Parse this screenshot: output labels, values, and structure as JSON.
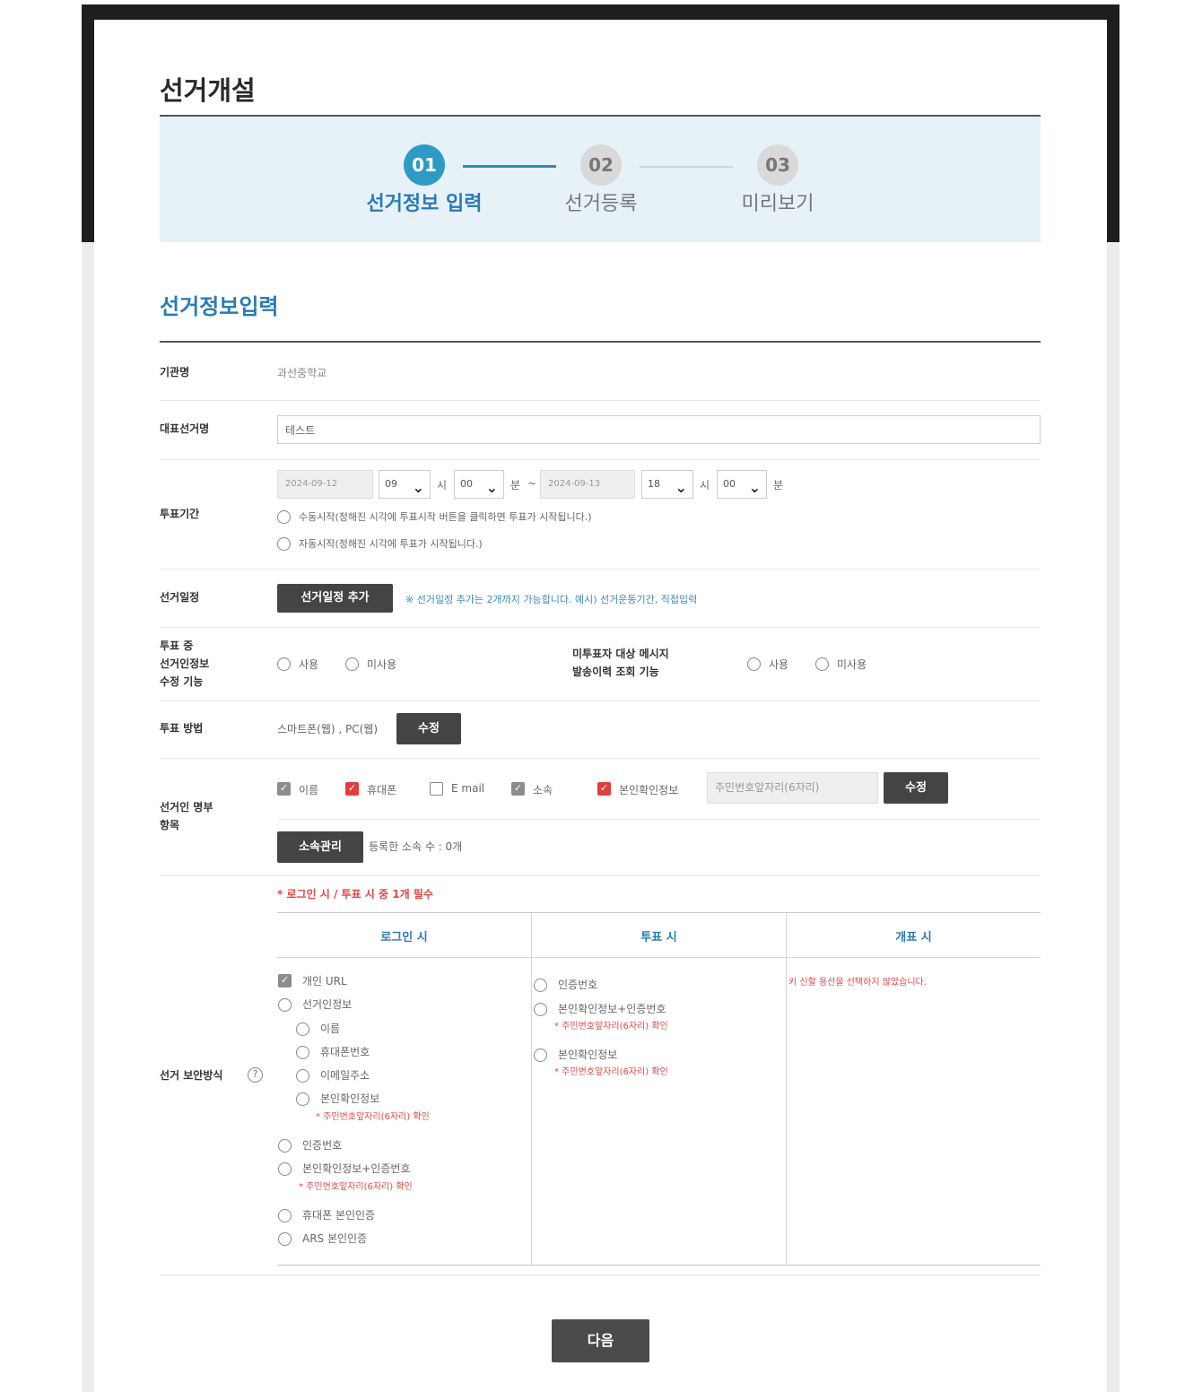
{
  "page_title": "선거개설",
  "steps": [
    {
      "num": "01",
      "label": "선거정보 입력",
      "active": true
    },
    {
      "num": "02",
      "label": "선거등록",
      "active": false
    },
    {
      "num": "03",
      "label": "미리보기",
      "active": false
    }
  ],
  "section_title": "선거정보입력",
  "org": {
    "label": "기관명",
    "value": "과선중학교"
  },
  "election_name": {
    "label": "대표선거명",
    "value": "테스트"
  },
  "vote_period": {
    "label": "투표기간",
    "start_date": "2024-09-12",
    "start_hour": "09",
    "start_min": "00",
    "end_date": "2024-09-13",
    "end_hour": "18",
    "end_min": "00",
    "unit_hour": "시",
    "unit_min": "분",
    "tilde": "~",
    "manual_start": "수동시작(정해진 시각에 투표시작 버튼을 클릭하면 투표가 시작됩니다.)",
    "auto_start": "자동시작(정해진 시각에 투표가 시작됩니다.)"
  },
  "schedule": {
    "label": "선거일정",
    "button": "선거일정 추가",
    "note": "※ 선거일정 추가는 2개까지 가능합니다. 예시) 선거운동기간, 직접입력"
  },
  "edit_feature": {
    "label": "투표 중\n선거인정보\n수정 기능",
    "use": "사용",
    "no_use": "미사용",
    "msg_label": "미투표자 대상 메시지\n발송이력 조회 기능",
    "msg_use": "사용",
    "msg_no_use": "미사용"
  },
  "vote_method": {
    "label": "투표 방법",
    "value": "스마트폰(웹) , PC(웹)",
    "button": "수정"
  },
  "voter_items": {
    "label": "선거인 명부\n항목",
    "items": [
      {
        "name": "이름",
        "state": "gray"
      },
      {
        "name": "휴대폰",
        "state": "red"
      },
      {
        "name": "E mail",
        "state": "off"
      },
      {
        "name": "소속",
        "state": "gray"
      },
      {
        "name": "본인확인정보",
        "state": "red"
      }
    ],
    "id_placeholder": "주민번호앞자리(6자리)",
    "edit_button": "수정",
    "affil_button": "소속관리",
    "affil_count": "등록한 소속 수 : 0개"
  },
  "security": {
    "label": "선거 보안방식",
    "help_icon": "?",
    "required_note": "* 로그인 시 / 투표 시 중 1개 필수",
    "col_login": "로그인 시",
    "col_vote": "투표 시",
    "col_count": "개표 시",
    "login_opts": {
      "personal_url": "개인 URL",
      "voter_info": "선거인정보",
      "name": "이름",
      "phone": "휴대폰번호",
      "email": "이메일주소",
      "id_info": "본인확인정보",
      "id_note1": "* 주민번호앞자리(6자리) 확인",
      "auth_code": "인증번호",
      "id_auth": "본인확인정보+인증번호",
      "id_note2": "* 주민번호앞자리(6자리) 확인",
      "phone_cert": "휴대폰 본인인증",
      "ars_cert": "ARS 본인인증"
    },
    "vote_opts": {
      "auth_code": "인증번호",
      "id_auth": "본인확인정보+인증번호",
      "id_note1": "* 주민번호앞자리(6자리) 확인",
      "id_info": "본인확인정보",
      "id_note2": "* 주민번호앞자리(6자리) 확인"
    },
    "count_note": "키 신할 용선을 선택하지 않았습니다."
  },
  "next_button": "다음"
}
